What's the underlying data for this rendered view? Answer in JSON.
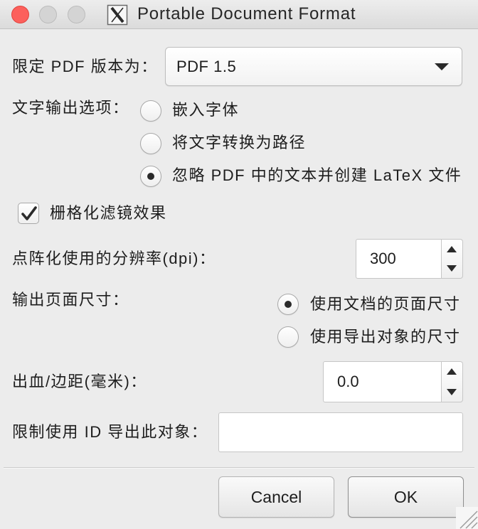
{
  "window": {
    "title": "Portable Document Format"
  },
  "pdf_version": {
    "label": "限定 PDF 版本为：",
    "selected": "PDF 1.5"
  },
  "text_output": {
    "label": "文字输出选项：",
    "options": [
      {
        "label": "嵌入字体",
        "checked": false
      },
      {
        "label": "将文字转换为路径",
        "checked": false
      },
      {
        "label": "忽略 PDF 中的文本并创建 LaTeX 文件",
        "checked": true
      }
    ]
  },
  "rasterize_filters": {
    "label": "栅格化滤镜效果",
    "checked": true
  },
  "resolution": {
    "label": "点阵化使用的分辨率(dpi)：",
    "value": "300"
  },
  "page_size": {
    "label": "输出页面尺寸：",
    "options": [
      {
        "label": "使用文档的页面尺寸",
        "checked": true
      },
      {
        "label": "使用导出对象的尺寸",
        "checked": false
      }
    ]
  },
  "bleed": {
    "label": "出血/边距(毫米)：",
    "value": "0.0"
  },
  "export_id": {
    "label": "限制使用 ID 导出此对象：",
    "value": ""
  },
  "buttons": {
    "cancel": "Cancel",
    "ok": "OK"
  },
  "icons": {
    "app": "x11-icon",
    "dropdown": "chevron-down-icon",
    "checkbox": "checkmark-icon",
    "stepper_up": "triangle-up-icon",
    "stepper_down": "triangle-down-icon",
    "resize": "resize-grip-icon"
  },
  "colors": {
    "close_button": "#fc605c",
    "inactive_light": "#d4d4d4",
    "window_bg": "#ececec"
  }
}
